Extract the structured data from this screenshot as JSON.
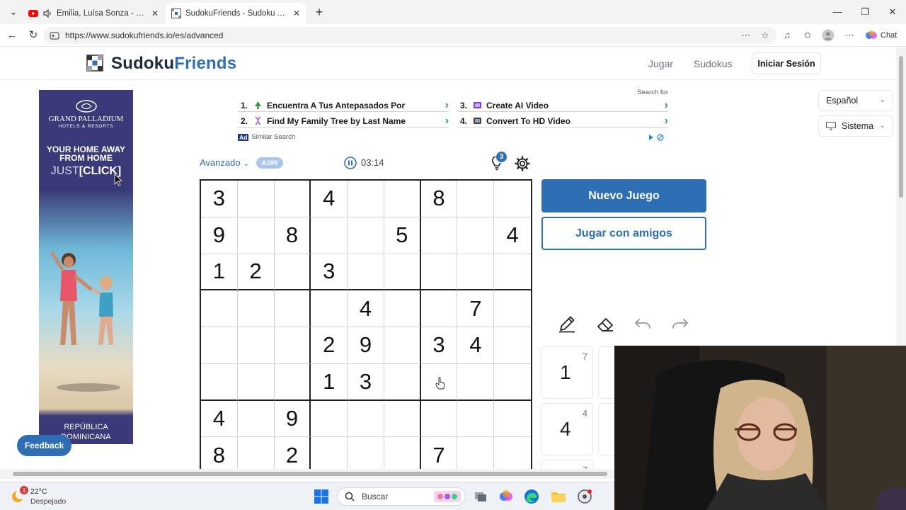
{
  "browser": {
    "tabs": [
      {
        "title": "Emilia, Luísa Sonza - bunda",
        "active": false
      },
      {
        "title": "SudokuFriends - Sudoku Avanzado",
        "active": true
      }
    ],
    "url": "https://www.sudokufriends.io/es/advanced",
    "chat_label": "Chat"
  },
  "site": {
    "logo_main": "Sudoku",
    "logo_accent": "Friends",
    "nav": [
      "Jugar",
      "Sudokus"
    ],
    "login_label": "Iniciar Sesión",
    "language": "Español",
    "theme": "Sistema",
    "feedback_label": "Feedback"
  },
  "left_ad": {
    "brand": "GRAND PALLADIUM",
    "brand_sub": "HOTELS & RESORTS",
    "line1": "YOUR HOME AWAY",
    "line2": "FROM HOME",
    "line3_a": "JUST",
    "line3_b": "[CLICK]",
    "location1": "REPÚBLICA",
    "location2": "DOMINICANA"
  },
  "top_ad": {
    "search_for": "Search for",
    "items": [
      {
        "num": "1.",
        "text": "Encuentra A Tus Antepasados Por"
      },
      {
        "num": "2.",
        "text": "Find My Family Tree by Last Name"
      },
      {
        "num": "3.",
        "text": "Create AI Video"
      },
      {
        "num": "4.",
        "text": "Convert To HD Video"
      }
    ],
    "ad_label": "Ad",
    "footer": "Similar Search"
  },
  "game": {
    "difficulty": "Avanzado",
    "badge": "A399",
    "timer": "03:14",
    "hints": "3",
    "new_game_label": "Nuevo Juego",
    "friends_label": "Jugar con amigos",
    "board": [
      [
        "3",
        "",
        "",
        "4",
        "",
        "",
        "8",
        "",
        ""
      ],
      [
        "9",
        "",
        "8",
        "",
        "",
        "5",
        "",
        "",
        "4"
      ],
      [
        "1",
        "2",
        "",
        "3",
        "",
        "",
        "",
        "",
        ""
      ],
      [
        "",
        "",
        "",
        "",
        "4",
        "",
        "",
        "7",
        ""
      ],
      [
        "",
        "",
        "",
        "2",
        "9",
        "",
        "3",
        "4",
        ""
      ],
      [
        "",
        "",
        "",
        "1",
        "3",
        "",
        "",
        "",
        ""
      ],
      [
        "4",
        "",
        "9",
        "",
        "",
        "",
        "",
        "",
        ""
      ],
      [
        "8",
        "",
        "2",
        "",
        "",
        "",
        "7",
        "",
        ""
      ],
      [
        "",
        "",
        "",
        "",
        "",
        "",
        "",
        "",
        ""
      ]
    ],
    "numpad": [
      {
        "digit": "1",
        "remaining": "7"
      },
      {
        "digit": "4",
        "remaining": "4"
      },
      {
        "digit": "",
        "remaining": "7"
      }
    ]
  },
  "taskbar": {
    "weather_badge": "1",
    "temperature": "22°C",
    "condition": "Despejado",
    "search_placeholder": "Buscar"
  },
  "colors": {
    "brand_blue": "#2e6eb5",
    "badge_blue": "#a8c7ea",
    "ad_green": "#2e9e48"
  }
}
